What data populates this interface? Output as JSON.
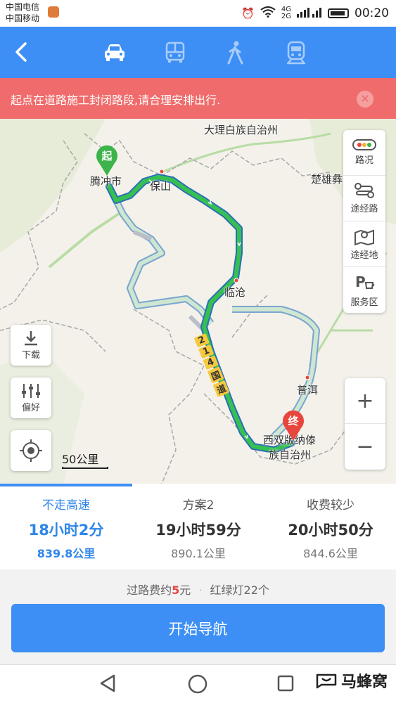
{
  "status_bar": {
    "carrier1": "中国电信",
    "carrier2": "中国移动",
    "net1": "4G",
    "net2": "2G",
    "time": "00:20"
  },
  "header": {
    "modes": [
      "car-icon",
      "bus-icon",
      "walk-icon",
      "train-icon"
    ],
    "active_mode": "car"
  },
  "alert": {
    "text": "起点在道路施工封闭路段,请合理安排出行.",
    "close": "✕"
  },
  "map": {
    "start_marker": "起",
    "end_marker": "终",
    "places": {
      "dali": "大理白族自治州",
      "tengchong": "腾冲市",
      "baoshan": "保山",
      "chuxiong": "楚雄彝",
      "lincang": "临沧",
      "puer": "普洱",
      "xishuangbanna_1": "西双版纳傣",
      "xishuangbanna_2": "族自治州"
    },
    "road_label": [
      "2",
      "1",
      "4",
      "国",
      "道"
    ],
    "scale": "50公里"
  },
  "right_panel": [
    "路况",
    "途经路",
    "途经地",
    "服务区"
  ],
  "left_buttons": {
    "download": "下载",
    "preference": "偏好"
  },
  "zoom": {
    "in": "+",
    "out": "−"
  },
  "routes": [
    {
      "name": "不走高速",
      "time": "18小时2分",
      "distance": "839.8公里",
      "active": true
    },
    {
      "name": "方案2",
      "time": "19小时59分",
      "distance": "890.1公里",
      "active": false
    },
    {
      "name": "收费较少",
      "time": "20小时50分",
      "distance": "844.6公里",
      "active": false
    }
  ],
  "info": {
    "toll_prefix": "过路费约",
    "toll_amount": "5",
    "toll_suffix": "元",
    "lights": "红绿灯22个"
  },
  "start_button": "开始导航",
  "watermark": "马蜂窝",
  "colors": {
    "primary": "#3d8ff5",
    "alert": "#f06b6b",
    "route": "#2fb24f",
    "start_pin": "#3cb44b",
    "end_pin": "#e8453c"
  }
}
